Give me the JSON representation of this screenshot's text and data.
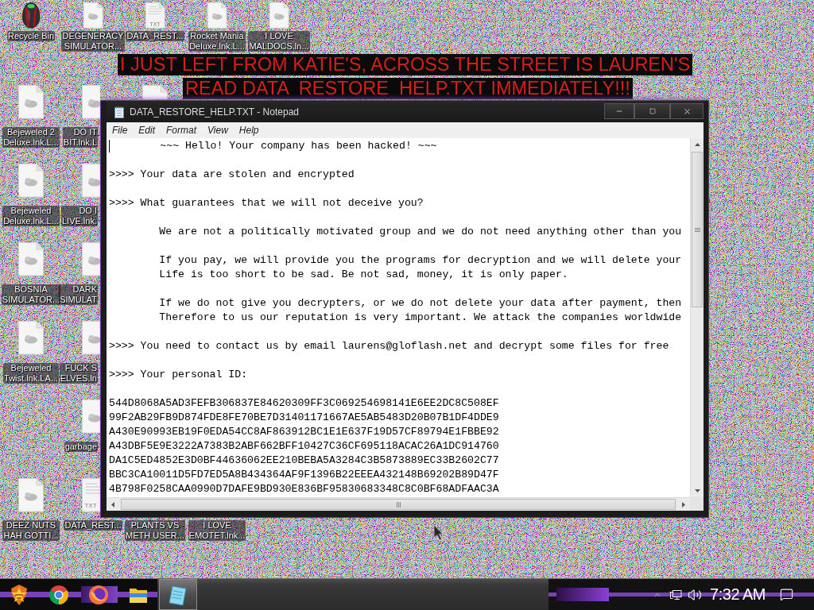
{
  "desktop_icons": [
    {
      "kind": "bin",
      "label": [
        "Recycle Bin"
      ]
    },
    {
      "kind": "shortcut",
      "label": [
        "DEGENERACY",
        "SIMULATOR..."
      ]
    },
    {
      "kind": "text",
      "badge": "TXT",
      "label": [
        "DATA_REST..."
      ]
    },
    {
      "kind": "shortcut",
      "label": [
        "Rocket Mania",
        "Deluxe.lnk.L..."
      ]
    },
    {
      "kind": "shortcut",
      "label": [
        "I LOVE",
        "MALDOCS.ln..."
      ]
    },
    {
      "kind": "shortcut",
      "label": [
        "Bejeweled 2",
        "Deluxe.lnk.L..."
      ]
    },
    {
      "kind": "shortcut",
      "label": [
        "DO IT",
        "BIT.lnk.L"
      ]
    },
    {
      "kind": "shortcut"
    },
    {
      "kind": "shortcut",
      "label": [
        "Bejeweled",
        "Deluxe.lnk.L..."
      ]
    },
    {
      "kind": "shortcut",
      "label": [
        "DO I",
        "LIVE.lnk."
      ]
    },
    {
      "kind": "shortcut",
      "label": [
        "BOSNIA",
        "SIMULATOR..."
      ]
    },
    {
      "kind": "shortcut",
      "label": [
        "DARK",
        "SIMULAT"
      ]
    },
    {
      "kind": "shortcut",
      "label": [
        "Bejeweled",
        "Twist.lnk.LA..."
      ]
    },
    {
      "kind": "shortcut",
      "label": [
        "FUCK S",
        "ELVES.ln"
      ]
    },
    {
      "kind": "shortcut",
      "label": [
        "garbage"
      ]
    },
    {
      "kind": "shortcut",
      "label": [
        "DEEZ NUTS",
        "HAH GOTTI..."
      ]
    },
    {
      "kind": "text",
      "badge": "TXT",
      "label": [
        "DATA_REST..."
      ]
    },
    {
      "label": [
        "PLANTS VS",
        "METH USER..."
      ]
    },
    {
      "label": [
        "I LOVE",
        "EMOTET.lnk..."
      ]
    }
  ],
  "banners": [
    "I JUST LEFT FROM KATIE'S, ACROSS THE STREET IS LAUREN'S",
    "READ DATA  RESTORE  HELP.TXT IMMEDIATELY!!!"
  ],
  "notepad": {
    "title": "DATA_RESTORE_HELP.TXT - Notepad",
    "menu": [
      "File",
      "Edit",
      "Format",
      "View",
      "Help"
    ],
    "paragraphs": [
      [
        "\t~~~ Hello! Your company has been hacked! ~~~"
      ],
      [
        ">>>> Your data are stolen and encrypted"
      ],
      [
        ">>>> What guarantees that we will not deceive you?"
      ],
      [
        "\tWe are not a politically motivated group and we do not need anything other than you"
      ],
      [
        "\tIf you pay, we will provide you the programs for decryption and we will delete your",
        "\tLife is too short to be sad. Be not sad, money, it is only paper."
      ],
      [
        "\tIf we do not give you decrypters, or we do not delete your data after payment, then",
        "\tTherefore to us our reputation is very important. We attack the companies worldwide"
      ],
      [
        ">>>> You need to contact us by email laurens@gloflash.net and decrypt some files for free"
      ],
      [
        ">>>> Your personal ID:"
      ],
      [
        "544D8068A5AD3FEFB306837E84620309FF3C069254698141E6EE2DC8C508EF",
        "99F2AB29FB9D874FDE8FE70BE7D31401171667AE5AB5483D20B07B1DF4DDE9",
        "A430E90993EB19F0EDA54CC8AF863912BC1E1E637F19D57CF89794E1FBBE92",
        "A43DBF5E9E3222A7383B2ABF662BFF10427C36CF695118ACAC26A1DC914760",
        "DA1C5ED4852E3D0BF44636062EE210BEBA5A3284C3B5873889EC33B2602C77",
        "BBC3CA10011D5FD7ED5A8B434364AF9F1396B22EEEA432148B69202B89D47F",
        "4B798F0258CAA0990D7DAFE9BD930E836BF95830683348C8C0BF68ADFAAC3A"
      ]
    ]
  },
  "taskbar": {
    "apps": [
      {
        "kind": "emblem",
        "active": false
      },
      {
        "kind": "wheel",
        "active": false
      },
      {
        "kind": "fox",
        "active": false
      },
      {
        "kind": "folder",
        "active": false
      },
      {
        "kind": "notepad",
        "active": true
      }
    ],
    "clock": "7:32 AM"
  }
}
